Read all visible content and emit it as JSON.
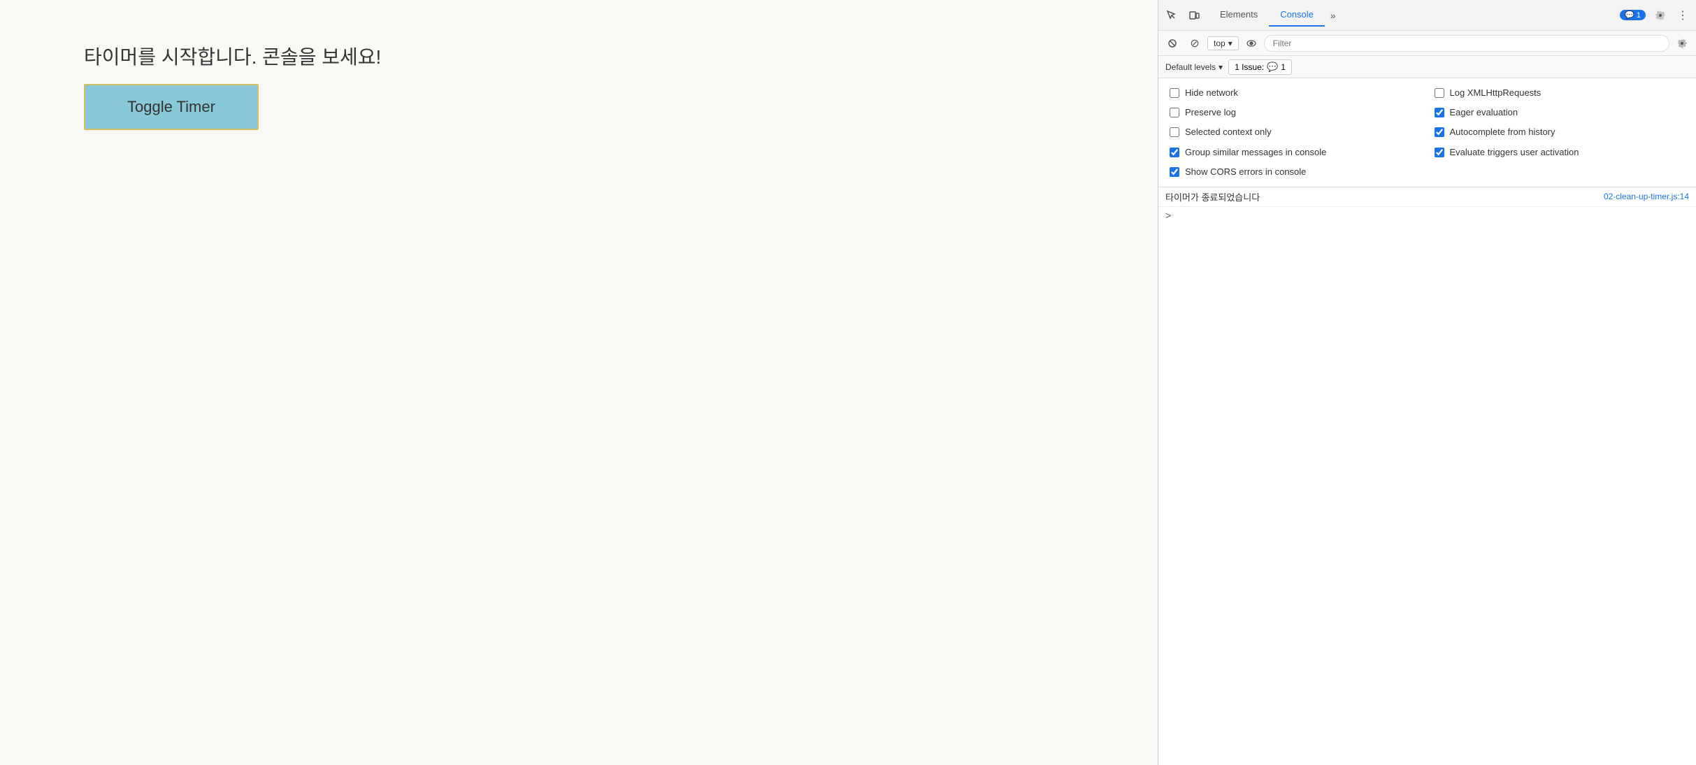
{
  "page": {
    "text": "타이머를 시작합니다. 콘솔을 보세요!",
    "button_label": "Toggle Timer"
  },
  "devtools": {
    "tabs": [
      {
        "id": "elements",
        "label": "Elements",
        "active": false
      },
      {
        "id": "console",
        "label": "Console",
        "active": true
      }
    ],
    "tab_more_label": "»",
    "badge_count": "1",
    "badge_icon": "💬",
    "toolbar": {
      "execute_icon": "▶",
      "block_icon": "🚫",
      "context_label": "top",
      "context_chevron": "▾",
      "eye_icon": "👁",
      "filter_placeholder": "Filter",
      "settings_icon": "⚙"
    },
    "levels": {
      "label": "Default levels",
      "chevron": "▾"
    },
    "issues": {
      "label": "1 Issue:",
      "count": "1",
      "icon": "💬"
    },
    "settings": {
      "items_left": [
        {
          "id": "hide-network",
          "label": "Hide network",
          "checked": false
        },
        {
          "id": "preserve-log",
          "label": "Preserve log",
          "checked": false
        },
        {
          "id": "selected-context",
          "label": "Selected context only",
          "checked": false
        },
        {
          "id": "group-similar",
          "label": "Group similar messages in console",
          "checked": true
        },
        {
          "id": "show-cors",
          "label": "Show CORS errors in console",
          "checked": true
        }
      ],
      "items_right": [
        {
          "id": "log-xmlhttp",
          "label": "Log XMLHttpRequests",
          "checked": false
        },
        {
          "id": "eager-eval",
          "label": "Eager evaluation",
          "checked": true
        },
        {
          "id": "autocomplete-history",
          "label": "Autocomplete from history",
          "checked": true
        },
        {
          "id": "evaluate-triggers",
          "label": "Evaluate triggers user activation",
          "checked": true
        }
      ]
    },
    "log": {
      "entries": [
        {
          "text": "타이머가 종료되었습니다",
          "source": "02-clean-up-timer.js:14"
        }
      ],
      "expand_symbol": ">"
    }
  }
}
